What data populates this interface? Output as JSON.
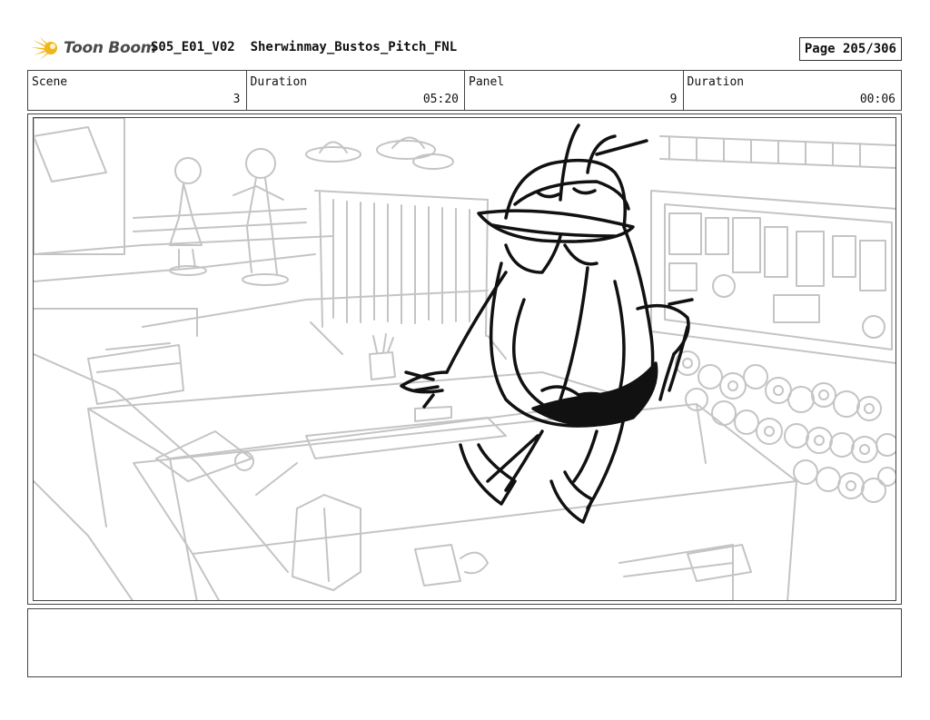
{
  "header": {
    "logo_text": "Toon Boom",
    "project_title": "S05_E01_V02  Sherwinmay_Bustos_Pitch_FNL",
    "page_label": "Page 205/306"
  },
  "info": [
    {
      "label": "Scene",
      "value": "3"
    },
    {
      "label": "Duration",
      "value": "05:20"
    },
    {
      "label": "Panel",
      "value": "9"
    },
    {
      "label": "Duration",
      "value": "00:06"
    }
  ],
  "notes": {
    "text": ""
  },
  "colors": {
    "sketch_light": "#c4c4c4",
    "sketch_dark": "#111111",
    "logo_yellow": "#f2b51a"
  }
}
